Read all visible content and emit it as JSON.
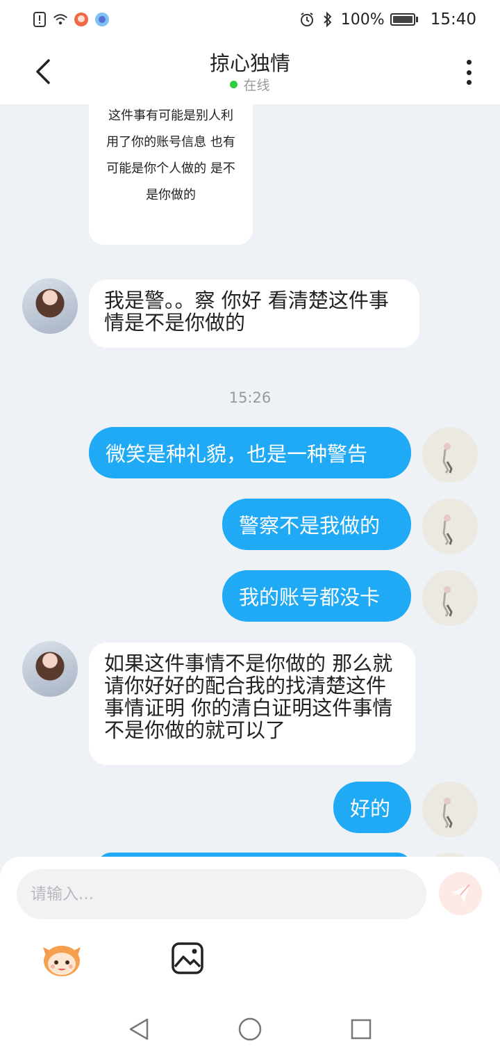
{
  "status_bar": {
    "battery": "100%",
    "time": "15:40",
    "icons": [
      "alert-icon",
      "wifi-icon",
      "app-notification-icon",
      "app-badge-icon",
      "alarm-icon",
      "bluetooth-icon",
      "battery-icon"
    ]
  },
  "header": {
    "title": "掠心独情",
    "status": "在线",
    "online_color": "#2ecc40"
  },
  "messages": [
    {
      "direction": "in",
      "text": "这件事有可能是别人利用了你的账号信息 也有可能是你个人做的 是不是你做的"
    },
    {
      "direction": "in",
      "text": "我是警。。察 你好 看清楚这件事情是不是你做的"
    },
    {
      "type": "timestamp",
      "text": "15:26"
    },
    {
      "direction": "out",
      "text": "微笑是种礼貌，也是一种警告"
    },
    {
      "direction": "out",
      "text": "警察不是我做的"
    },
    {
      "direction": "out",
      "text": "我的账号都没卡"
    },
    {
      "direction": "in",
      "text": "如果这件事情不是你做的 那么就请你好好的配合我的找清楚这件事情证明 你的清白证明这件事情不是你做的就可以了"
    },
    {
      "direction": "out",
      "text": "好的"
    }
  ],
  "input": {
    "placeholder": "请输入..."
  },
  "colors": {
    "outgoing_bubble": "#20a9f5",
    "background": "#eef2f7",
    "send_button": "#f58a7a"
  }
}
